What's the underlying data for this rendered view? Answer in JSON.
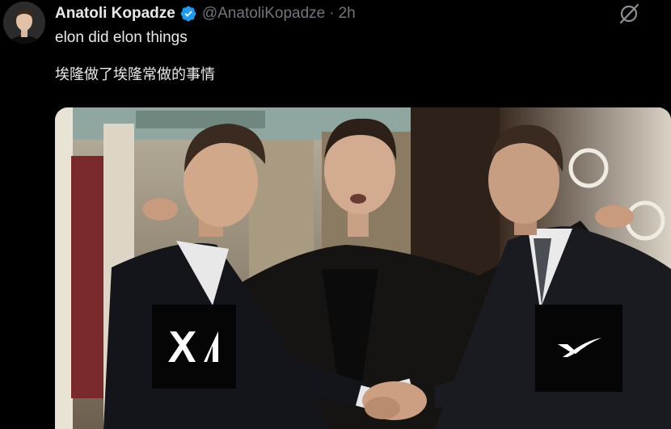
{
  "tweet": {
    "author_name": "Anatoli Kopadze",
    "handle": "@AnatoliKopadze",
    "separator": "·",
    "time": "2h",
    "verified": true,
    "text_line1": "elon did elon things",
    "text_line2": "埃隆做了埃隆常做的事情"
  },
  "icons": {
    "verified": "verified-badge-icon",
    "grok": "grok-icon",
    "logo_left": "xai-logo",
    "logo_right": "spacex-logo"
  },
  "colors": {
    "background": "#000000",
    "text": "#e7e9ea",
    "secondary_text": "#71767b",
    "verified_blue": "#1d9bf0"
  }
}
